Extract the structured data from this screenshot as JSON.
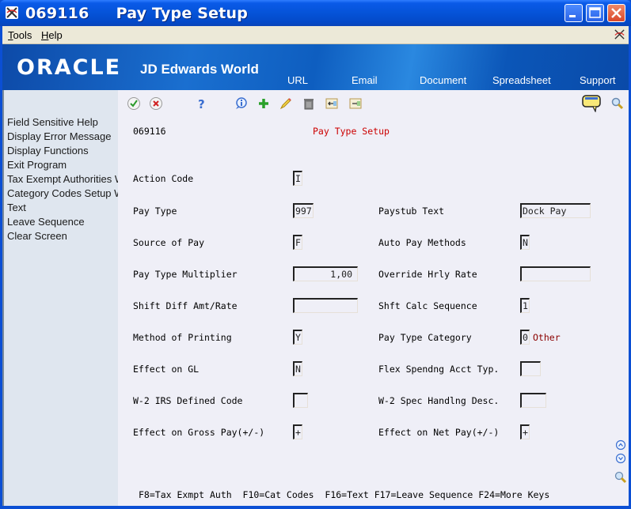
{
  "window": {
    "title": "069116     Pay Type Setup",
    "controls": [
      "minimize",
      "maximize",
      "close"
    ]
  },
  "menubar": {
    "items": [
      {
        "label": "Tools",
        "accel": "T",
        "rest": "ools"
      },
      {
        "label": "Help",
        "accel": "H",
        "rest": "elp"
      }
    ]
  },
  "banner": {
    "logo": "ORACLE",
    "product": "JD Edwards World",
    "links": [
      "URL",
      "Email",
      "Document",
      "Spreadsheet",
      "Support"
    ]
  },
  "toolbar": {
    "icons": [
      "ok-check-icon",
      "cancel-x-icon",
      "help-question-icon",
      "info-icon",
      "add-plus-icon",
      "edit-pencil-icon",
      "delete-trash-icon",
      "import-icon",
      "export-icon"
    ],
    "right_icons": [
      "message-bubble-icon",
      "search-magnifier-icon"
    ]
  },
  "sidebar": {
    "items": [
      "Field Sensitive Help",
      "Display Error Message",
      "Display Functions",
      "Exit Program",
      "Tax Exempt Authorities W",
      "Category Codes Setup W",
      "Text",
      "Leave Sequence",
      "Clear Screen"
    ]
  },
  "form": {
    "program_id": "069116",
    "title": "Pay Type Setup",
    "action_code": {
      "label": "Action Code",
      "value": "I"
    },
    "left": [
      {
        "label": "Pay Type",
        "value": "997"
      },
      {
        "label": "Source of Pay",
        "value": "F"
      },
      {
        "label": "Pay Type Multiplier",
        "value": "1,00"
      },
      {
        "label": "Shift Diff Amt/Rate",
        "value": ""
      },
      {
        "label": "Method of Printing",
        "value": "Y"
      },
      {
        "label": "Effect on GL",
        "value": "N"
      },
      {
        "label": "W-2 IRS Defined Code",
        "value": ""
      },
      {
        "label": "Effect on Gross Pay(+/-)",
        "value": "+"
      }
    ],
    "right": [
      {
        "label": "Paystub Text",
        "value": "Dock Pay"
      },
      {
        "label": "Auto Pay Methods",
        "value": "N"
      },
      {
        "label": "Override Hrly Rate",
        "value": ""
      },
      {
        "label": "Shft Calc Sequence",
        "value": "1"
      },
      {
        "label": "Pay Type Category",
        "value": "0",
        "description": "Other"
      },
      {
        "label": "Flex Spendng Acct Typ.",
        "value": ""
      },
      {
        "label": "W-2 Spec Handlng Desc.",
        "value": ""
      },
      {
        "label": "Effect on Net Pay(+/-)",
        "value": "+"
      }
    ],
    "function_keys": "F8=Tax Exmpt Auth  F10=Cat Codes  F16=Text F17=Leave Sequence F24=More Keys"
  },
  "side_controls": [
    "scroll-up-icon",
    "scroll-down-icon",
    "zoom-magnifier-icon"
  ],
  "colors": {
    "title_accent": "#cc0000",
    "description": "#8b0000",
    "titlebar": "#0553d8"
  }
}
